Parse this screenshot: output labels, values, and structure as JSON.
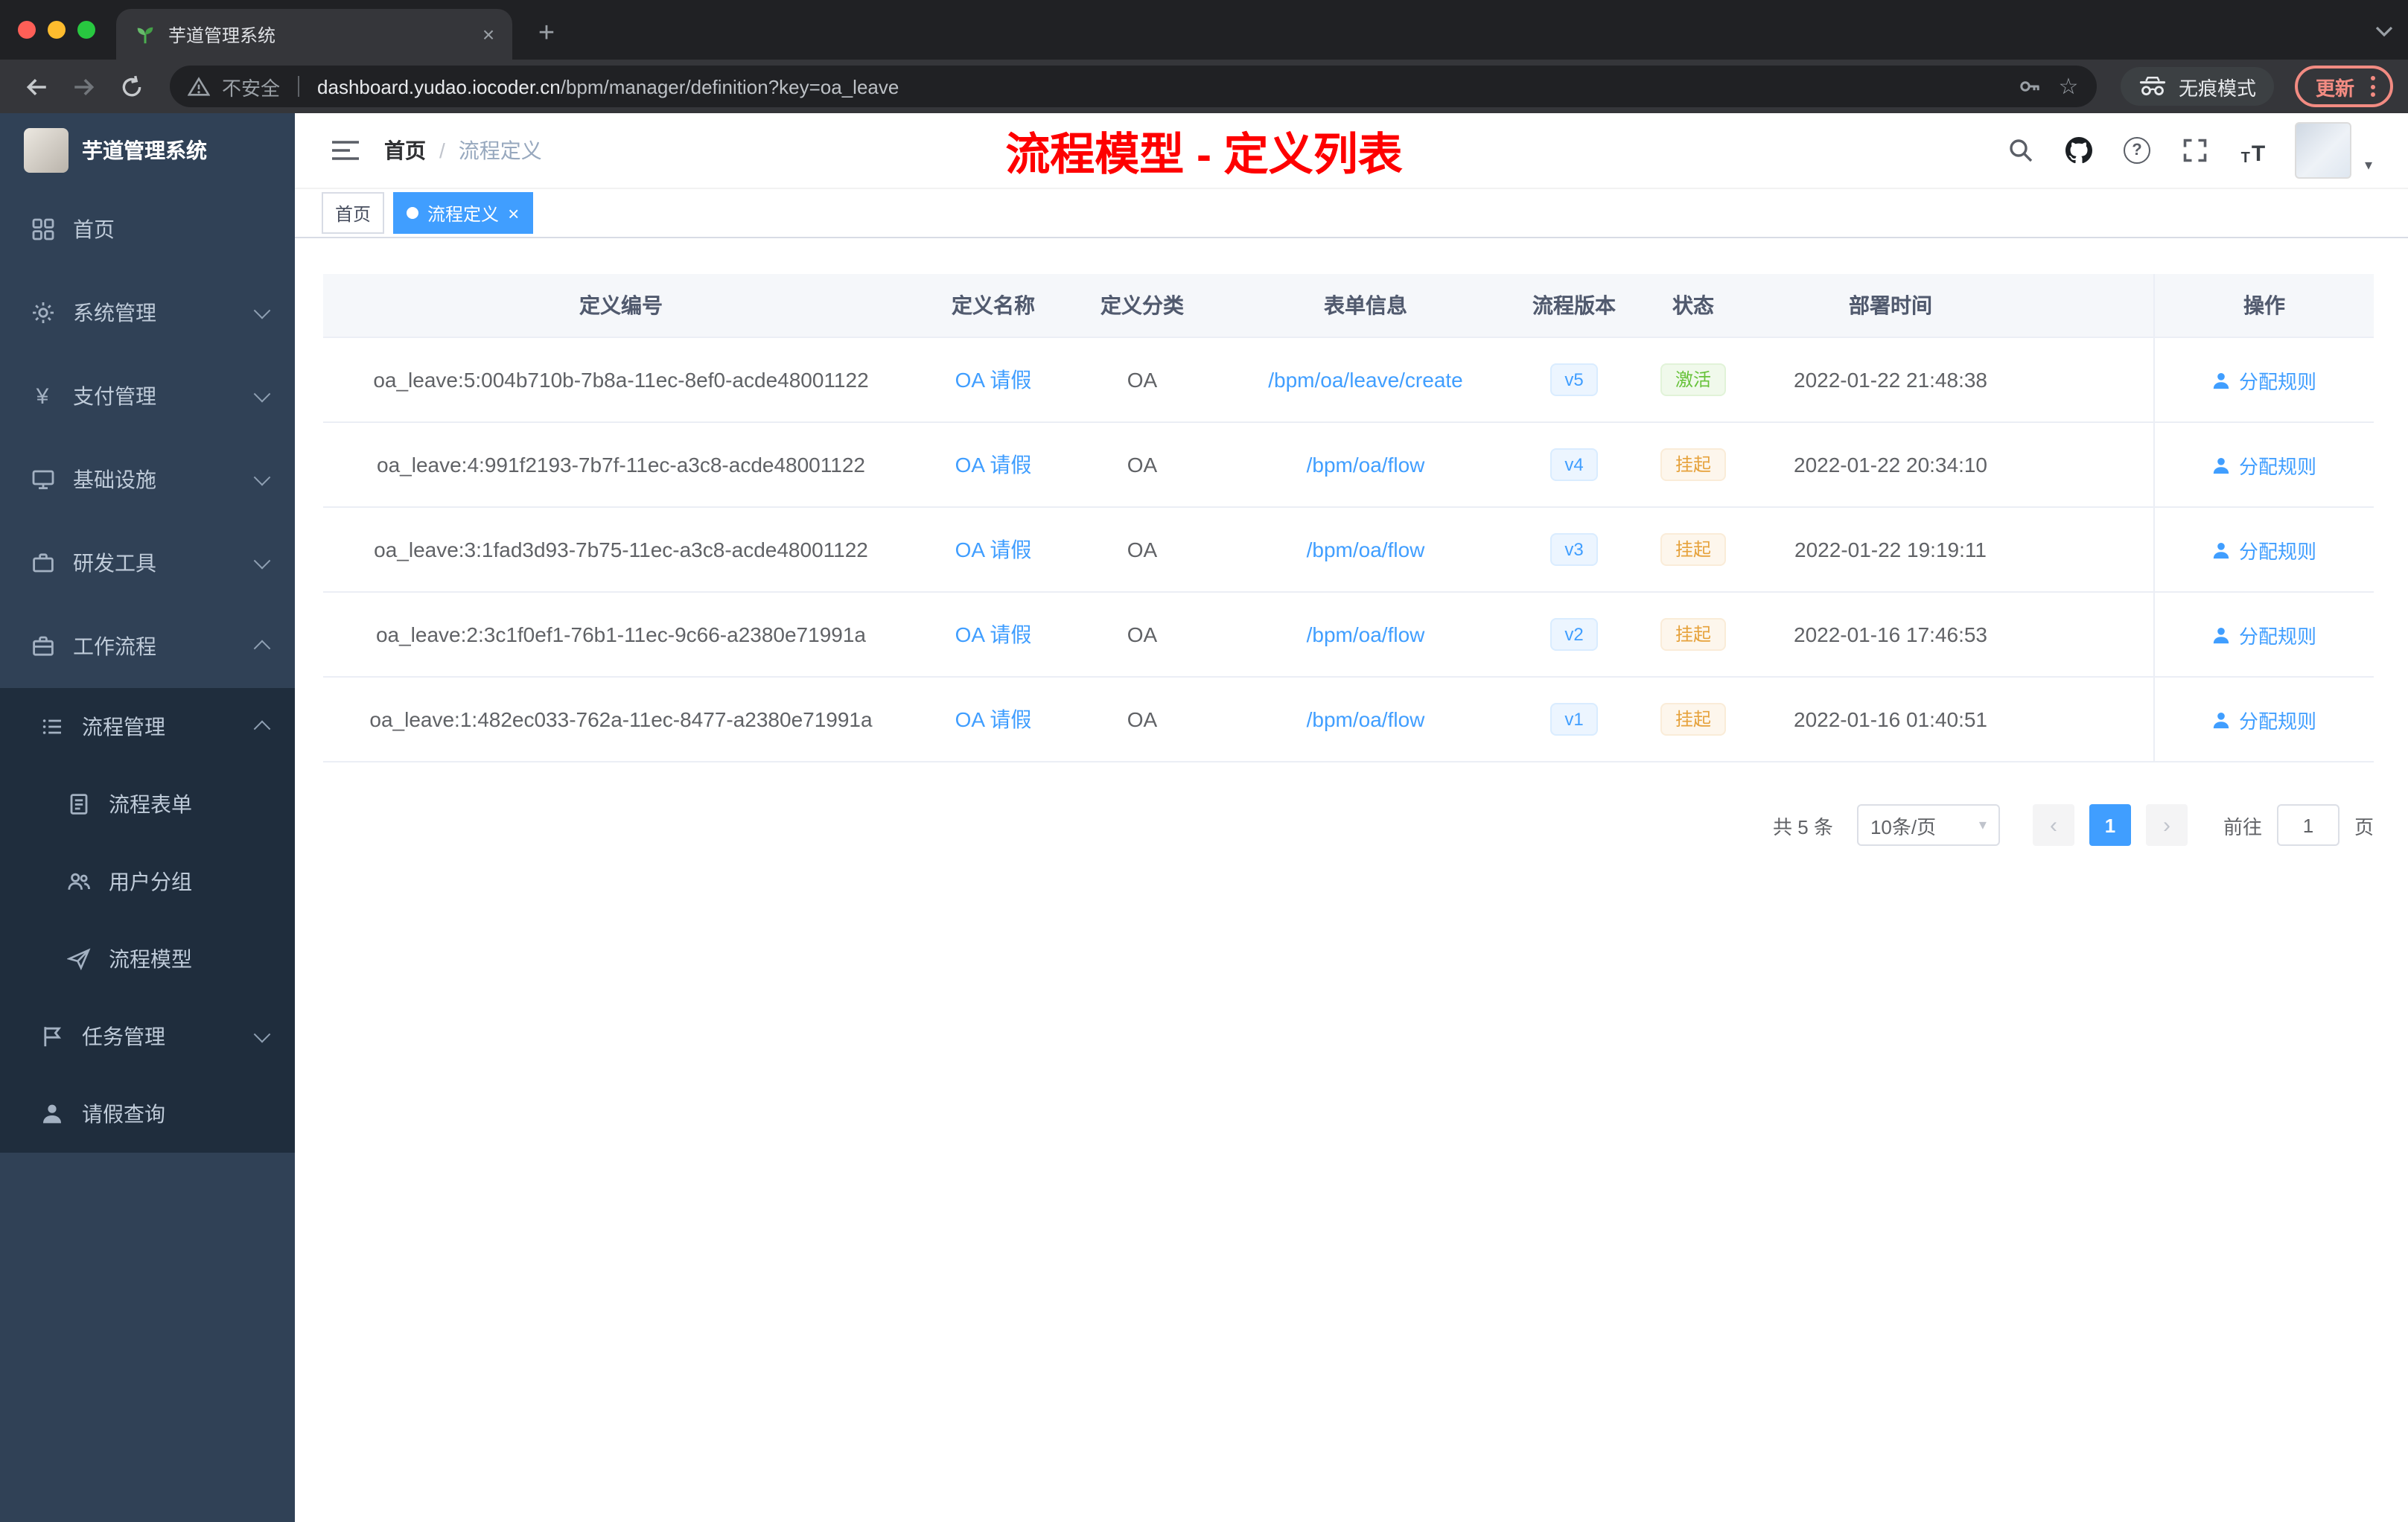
{
  "browser": {
    "tab_title": "芋道管理系统",
    "security_label": "不安全",
    "url_domain": "dashboard.yudao.iocoder.cn",
    "url_path": "/bpm/manager/definition?key=oa_leave",
    "incognito_label": "无痕模式",
    "update_label": "更新"
  },
  "icons": {
    "tab_close": "×",
    "new_tab": "+",
    "star": "☆",
    "caret_down": "▾",
    "prev": "‹",
    "next": "›",
    "breadcrumb_sep": "/",
    "tag_close": "×",
    "question": "?"
  },
  "sidebar": {
    "logo_title": "芋道管理系统",
    "menu": [
      {
        "label": "首页"
      },
      {
        "label": "系统管理"
      },
      {
        "label": "支付管理"
      },
      {
        "label": "基础设施"
      },
      {
        "label": "研发工具"
      },
      {
        "label": "工作流程"
      }
    ],
    "submenu": [
      {
        "label": "流程管理"
      },
      {
        "label": "流程表单"
      },
      {
        "label": "用户分组"
      },
      {
        "label": "流程模型"
      },
      {
        "label": "任务管理"
      },
      {
        "label": "请假查询"
      }
    ]
  },
  "navbar": {
    "breadcrumb_home": "首页",
    "breadcrumb_current": "流程定义"
  },
  "annotation": {
    "text": "流程模型 - 定义列表"
  },
  "tags": {
    "home": "首页",
    "active": "流程定义"
  },
  "table": {
    "headers": [
      "定义编号",
      "定义名称",
      "定义分类",
      "表单信息",
      "流程版本",
      "状态",
      "部署时间",
      "操作"
    ],
    "rows": [
      {
        "id": "oa_leave:5:004b710b-7b8a-11ec-8ef0-acde48001122",
        "name": "OA 请假",
        "category": "OA",
        "form": "/bpm/oa/leave/create",
        "version": "v5",
        "status": "激活",
        "status_type": "success",
        "time": "2022-01-22 21:48:38",
        "action": "分配规则"
      },
      {
        "id": "oa_leave:4:991f2193-7b7f-11ec-a3c8-acde48001122",
        "name": "OA 请假",
        "category": "OA",
        "form": "/bpm/oa/flow",
        "version": "v4",
        "status": "挂起",
        "status_type": "warning",
        "time": "2022-01-22 20:34:10",
        "action": "分配规则"
      },
      {
        "id": "oa_leave:3:1fad3d93-7b75-11ec-a3c8-acde48001122",
        "name": "OA 请假",
        "category": "OA",
        "form": "/bpm/oa/flow",
        "version": "v3",
        "status": "挂起",
        "status_type": "warning",
        "time": "2022-01-22 19:19:11",
        "action": "分配规则"
      },
      {
        "id": "oa_leave:2:3c1f0ef1-76b1-11ec-9c66-a2380e71991a",
        "name": "OA 请假",
        "category": "OA",
        "form": "/bpm/oa/flow",
        "version": "v2",
        "status": "挂起",
        "status_type": "warning",
        "time": "2022-01-16 17:46:53",
        "action": "分配规则"
      },
      {
        "id": "oa_leave:1:482ec033-762a-11ec-8477-a2380e71991a",
        "name": "OA 请假",
        "category": "OA",
        "form": "/bpm/oa/flow",
        "version": "v1",
        "status": "挂起",
        "status_type": "warning",
        "time": "2022-01-16 01:40:51",
        "action": "分配规则"
      }
    ]
  },
  "pagination": {
    "total": "共 5 条",
    "page_size": "10条/页",
    "current_page": "1",
    "goto_label": "前往",
    "goto_value": "1",
    "page_unit": "页"
  }
}
